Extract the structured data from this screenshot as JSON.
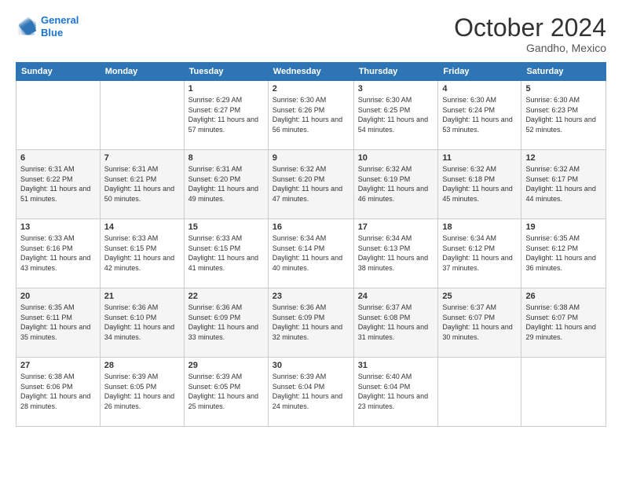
{
  "header": {
    "logo_line1": "General",
    "logo_line2": "Blue",
    "month": "October 2024",
    "location": "Gandho, Mexico"
  },
  "weekdays": [
    "Sunday",
    "Monday",
    "Tuesday",
    "Wednesday",
    "Thursday",
    "Friday",
    "Saturday"
  ],
  "weeks": [
    [
      {
        "day": "",
        "info": ""
      },
      {
        "day": "",
        "info": ""
      },
      {
        "day": "1",
        "info": "Sunrise: 6:29 AM\nSunset: 6:27 PM\nDaylight: 11 hours and 57 minutes."
      },
      {
        "day": "2",
        "info": "Sunrise: 6:30 AM\nSunset: 6:26 PM\nDaylight: 11 hours and 56 minutes."
      },
      {
        "day": "3",
        "info": "Sunrise: 6:30 AM\nSunset: 6:25 PM\nDaylight: 11 hours and 54 minutes."
      },
      {
        "day": "4",
        "info": "Sunrise: 6:30 AM\nSunset: 6:24 PM\nDaylight: 11 hours and 53 minutes."
      },
      {
        "day": "5",
        "info": "Sunrise: 6:30 AM\nSunset: 6:23 PM\nDaylight: 11 hours and 52 minutes."
      }
    ],
    [
      {
        "day": "6",
        "info": "Sunrise: 6:31 AM\nSunset: 6:22 PM\nDaylight: 11 hours and 51 minutes."
      },
      {
        "day": "7",
        "info": "Sunrise: 6:31 AM\nSunset: 6:21 PM\nDaylight: 11 hours and 50 minutes."
      },
      {
        "day": "8",
        "info": "Sunrise: 6:31 AM\nSunset: 6:20 PM\nDaylight: 11 hours and 49 minutes."
      },
      {
        "day": "9",
        "info": "Sunrise: 6:32 AM\nSunset: 6:20 PM\nDaylight: 11 hours and 47 minutes."
      },
      {
        "day": "10",
        "info": "Sunrise: 6:32 AM\nSunset: 6:19 PM\nDaylight: 11 hours and 46 minutes."
      },
      {
        "day": "11",
        "info": "Sunrise: 6:32 AM\nSunset: 6:18 PM\nDaylight: 11 hours and 45 minutes."
      },
      {
        "day": "12",
        "info": "Sunrise: 6:32 AM\nSunset: 6:17 PM\nDaylight: 11 hours and 44 minutes."
      }
    ],
    [
      {
        "day": "13",
        "info": "Sunrise: 6:33 AM\nSunset: 6:16 PM\nDaylight: 11 hours and 43 minutes."
      },
      {
        "day": "14",
        "info": "Sunrise: 6:33 AM\nSunset: 6:15 PM\nDaylight: 11 hours and 42 minutes."
      },
      {
        "day": "15",
        "info": "Sunrise: 6:33 AM\nSunset: 6:15 PM\nDaylight: 11 hours and 41 minutes."
      },
      {
        "day": "16",
        "info": "Sunrise: 6:34 AM\nSunset: 6:14 PM\nDaylight: 11 hours and 40 minutes."
      },
      {
        "day": "17",
        "info": "Sunrise: 6:34 AM\nSunset: 6:13 PM\nDaylight: 11 hours and 38 minutes."
      },
      {
        "day": "18",
        "info": "Sunrise: 6:34 AM\nSunset: 6:12 PM\nDaylight: 11 hours and 37 minutes."
      },
      {
        "day": "19",
        "info": "Sunrise: 6:35 AM\nSunset: 6:12 PM\nDaylight: 11 hours and 36 minutes."
      }
    ],
    [
      {
        "day": "20",
        "info": "Sunrise: 6:35 AM\nSunset: 6:11 PM\nDaylight: 11 hours and 35 minutes."
      },
      {
        "day": "21",
        "info": "Sunrise: 6:36 AM\nSunset: 6:10 PM\nDaylight: 11 hours and 34 minutes."
      },
      {
        "day": "22",
        "info": "Sunrise: 6:36 AM\nSunset: 6:09 PM\nDaylight: 11 hours and 33 minutes."
      },
      {
        "day": "23",
        "info": "Sunrise: 6:36 AM\nSunset: 6:09 PM\nDaylight: 11 hours and 32 minutes."
      },
      {
        "day": "24",
        "info": "Sunrise: 6:37 AM\nSunset: 6:08 PM\nDaylight: 11 hours and 31 minutes."
      },
      {
        "day": "25",
        "info": "Sunrise: 6:37 AM\nSunset: 6:07 PM\nDaylight: 11 hours and 30 minutes."
      },
      {
        "day": "26",
        "info": "Sunrise: 6:38 AM\nSunset: 6:07 PM\nDaylight: 11 hours and 29 minutes."
      }
    ],
    [
      {
        "day": "27",
        "info": "Sunrise: 6:38 AM\nSunset: 6:06 PM\nDaylight: 11 hours and 28 minutes."
      },
      {
        "day": "28",
        "info": "Sunrise: 6:39 AM\nSunset: 6:05 PM\nDaylight: 11 hours and 26 minutes."
      },
      {
        "day": "29",
        "info": "Sunrise: 6:39 AM\nSunset: 6:05 PM\nDaylight: 11 hours and 25 minutes."
      },
      {
        "day": "30",
        "info": "Sunrise: 6:39 AM\nSunset: 6:04 PM\nDaylight: 11 hours and 24 minutes."
      },
      {
        "day": "31",
        "info": "Sunrise: 6:40 AM\nSunset: 6:04 PM\nDaylight: 11 hours and 23 minutes."
      },
      {
        "day": "",
        "info": ""
      },
      {
        "day": "",
        "info": ""
      }
    ]
  ]
}
